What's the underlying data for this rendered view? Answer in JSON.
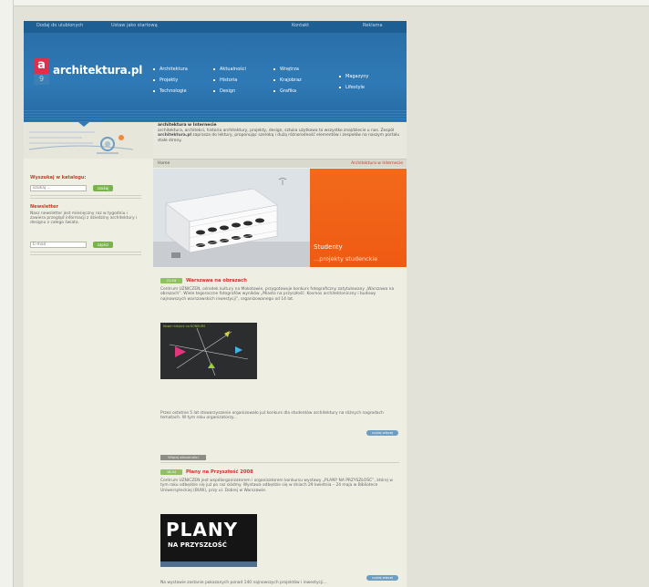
{
  "topbar": {
    "links": [
      "Dodaj do ulubionych",
      "Ustaw jako startową",
      "Kontakt",
      "Reklama"
    ]
  },
  "header": {
    "logo_mark": "a",
    "logo_sub": "9",
    "logo_text": "architektura.pl",
    "menu": [
      [
        "Architektura",
        "Projekty",
        "Technologie"
      ],
      [
        "Aktualności",
        "Historia",
        "Design"
      ],
      [
        "Wnętrza",
        "Krajobraz",
        "Grafika"
      ],
      [
        "Magazyny",
        "Lifestyle"
      ]
    ]
  },
  "about": {
    "title": "architektura w Internecie",
    "text_pre": "architektura, architekci, historia architektury, projekty, design, sztuka użytkowa to wszystko znajdziecie u nas. Zespół ",
    "text_brand": "architektura.pl",
    "text_post": " zaprasza do lektury, proponując szeroką i dużą różnorodność elementów i zespołów na naszym portalu stałe strony."
  },
  "breadcrumb": {
    "home": "Home",
    "right": "Architektura w Internecie"
  },
  "sidebar": {
    "search": {
      "heading": "Wyszukaj w katalogu:",
      "placeholder": "szukaj ...",
      "button": "szukaj"
    },
    "newsletter": {
      "heading": "Newsletter",
      "text": "Nasz newsletter jest miesięczny raz w tygodniu i zawiera przegląd informacji z dziedziny architektury i designu z całego świata.",
      "placeholder": "E-mail",
      "button": "zapisz"
    }
  },
  "hero": {
    "title": "Studenty",
    "subtitle": "...projekty studenckie"
  },
  "posts": [
    {
      "badge": "21.04",
      "title": "Warszawa na obrazach",
      "text": "Centrum UZNICZEN, ośrodek kultury na Mokotowie, przygotowuje konkurs fotograficzny zatytułowany „Warszawa na obrazach”. Wiele tegoroczne fotografów wyników „Miasto na przyszłość. Kosmos architektoniczny i budowy najnowszych warszawskich inwestycji”, organizowanego od 14 lat.",
      "thumb_label": "Nowe miejsce na KONKURS",
      "text2": "Przez ostatnie 5 lat stowarzyszenie organizowało już konkurs dla studentów architektury na różnych nagrodach tematach. W tym roku organizatorzy...",
      "more": "czytaj więcej"
    },
    {
      "badge": "18.04",
      "title": "Plany na Przyszłość 2008",
      "text": "Centrum UZNICZEN jest współorganizatorem i organizatorem konkursu wystawy „PLANY NA PRZYSZŁOŚĆ”, której w tym roku odbędzie się już po raz siódmy. Wystawa odbędzie się w dniach 29 kwietnia – 24 maja w Bibliotece Uniwersyteckiej (BUW), przy ul. Dobrej w Warszawie.",
      "thumb_line1": "PLANY",
      "thumb_line2": "NA PRZYSZŁOŚĆ",
      "text2": "Na wystawie zostanie pokazanych ponad 140 najnowszych projektów i inwestycji...",
      "more": "czytaj więcej"
    }
  ],
  "separator_label": "Więcej aktualności"
}
